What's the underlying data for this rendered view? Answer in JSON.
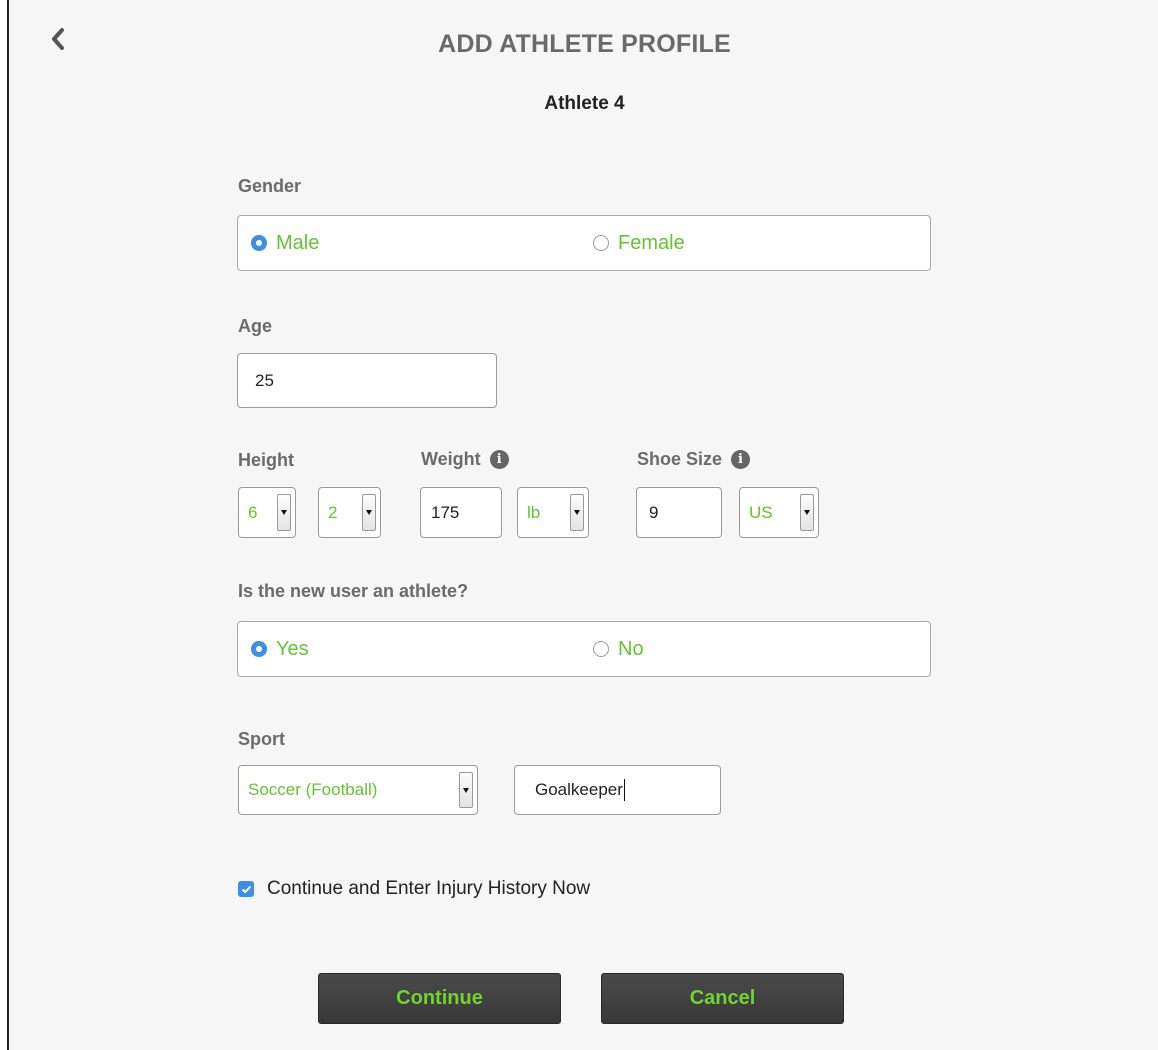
{
  "header": {
    "title": "ADD ATHLETE PROFILE",
    "subtitle": "Athlete 4",
    "back_icon": "chevron-left-icon"
  },
  "gender": {
    "label": "Gender",
    "options": [
      {
        "label": "Male",
        "selected": true
      },
      {
        "label": "Female",
        "selected": false
      }
    ]
  },
  "age": {
    "label": "Age",
    "value": "25"
  },
  "height": {
    "label": "Height",
    "feet": "6",
    "inches": "2"
  },
  "weight": {
    "label": "Weight",
    "value": "175",
    "unit": "lb",
    "info_icon": "info-icon"
  },
  "shoe_size": {
    "label": "Shoe Size",
    "value": "9",
    "unit": "US",
    "info_icon": "info-icon"
  },
  "is_athlete": {
    "label": "Is the new user an athlete?",
    "options": [
      {
        "label": "Yes",
        "selected": true
      },
      {
        "label": "No",
        "selected": false
      }
    ]
  },
  "sport": {
    "label": "Sport",
    "selected": "Soccer (Football)",
    "position": "Goalkeeper"
  },
  "injury_checkbox": {
    "label": "Continue and Enter Injury History Now",
    "checked": true
  },
  "actions": {
    "continue_label": "Continue",
    "cancel_label": "Cancel"
  },
  "colors": {
    "accent_green": "#63c431",
    "radio_blue": "#3d8fe6",
    "button_bg": "#404040"
  }
}
